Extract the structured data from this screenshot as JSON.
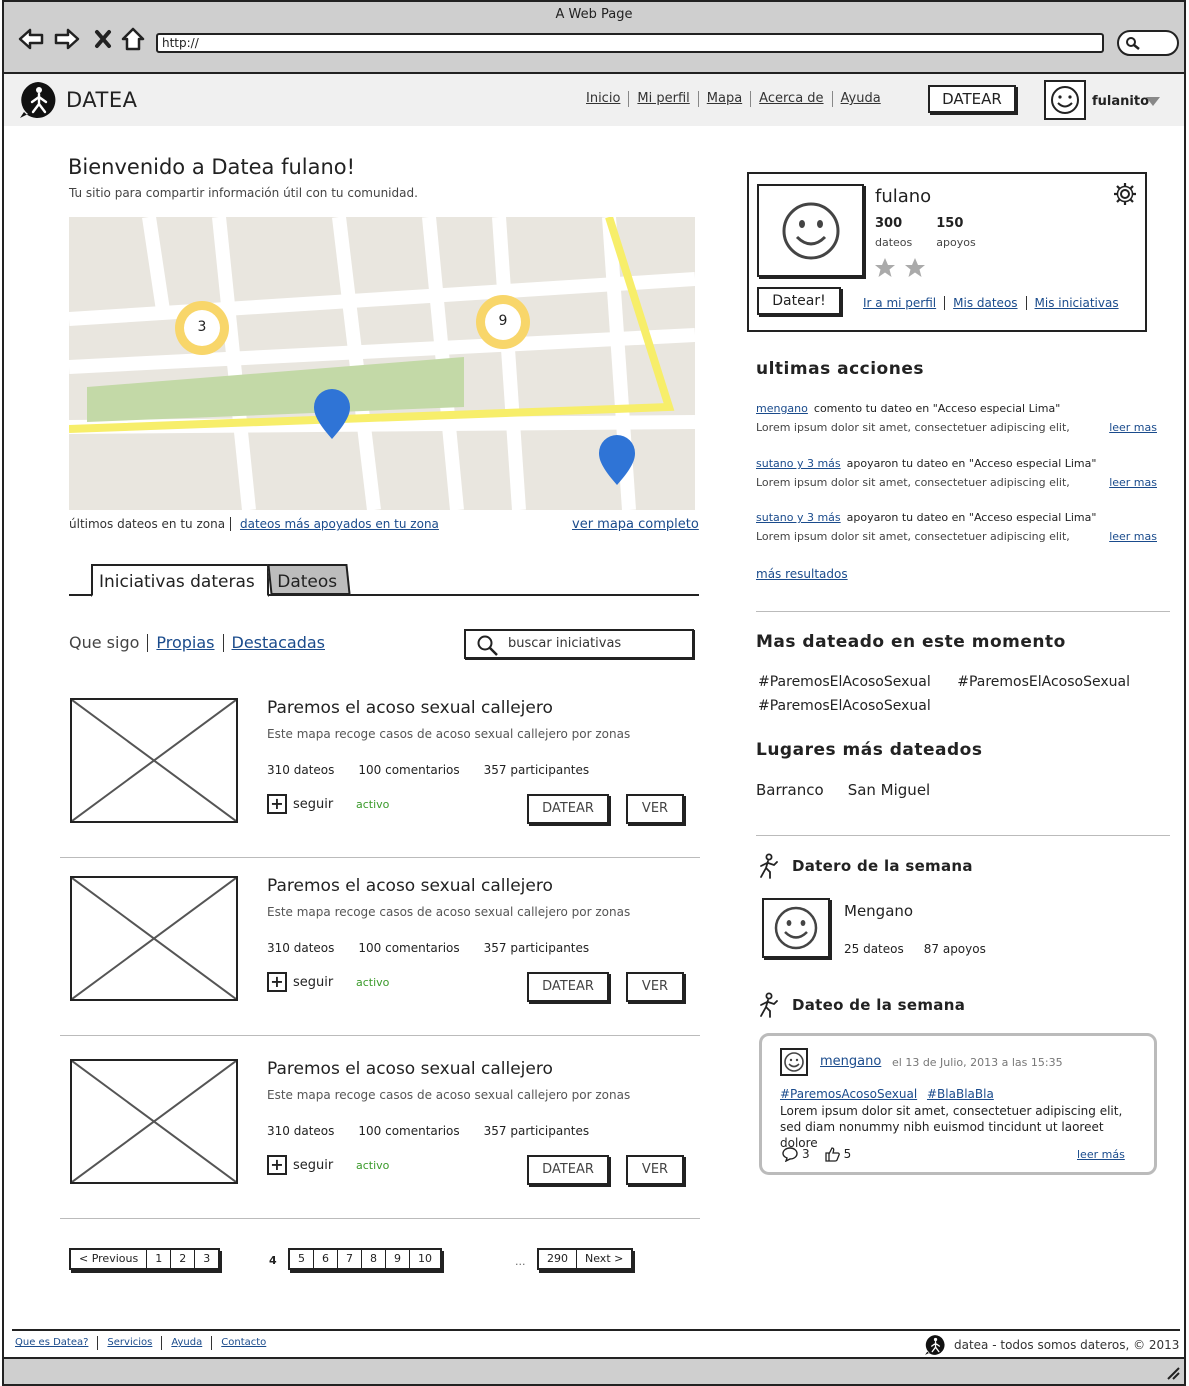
{
  "browser": {
    "title": "A Web Page",
    "url": "http://"
  },
  "header": {
    "logo_text": "DATEA",
    "nav": [
      "Inicio",
      "Mi perfil",
      "Mapa",
      "Acerca de",
      "Ayuda"
    ],
    "datear_button": "DATEAR",
    "username": "fulanito"
  },
  "welcome": {
    "title": "Bienvenido a Datea fulano!",
    "subtitle": "Tu sitio para compartir información útil con tu comunidad."
  },
  "map": {
    "clusters": [
      "3",
      "9"
    ],
    "caption_left": "últimos dateos en tu zona",
    "caption_mid": "dateos más apoyados en tu zona",
    "caption_right": "ver mapa completo"
  },
  "tabs": [
    "Iniciativas dateras",
    "Dateos"
  ],
  "filters": {
    "items": [
      "Que sigo",
      "Propias",
      "Destacadas"
    ],
    "search_placeholder": "buscar iniciativas"
  },
  "initiatives": [
    {
      "title": "Paremos el acoso sexual callejero",
      "desc": "Este mapa recoge casos de acoso sexual callejero por zonas",
      "dateos": "310 dateos",
      "comments": "100 comentarios",
      "participants": "357 participantes",
      "follow": "seguir",
      "state": "activo",
      "btn_datear": "DATEAR",
      "btn_ver": "VER"
    },
    {
      "title": "Paremos el acoso sexual callejero",
      "desc": "Este mapa recoge casos de acoso sexual callejero por zonas",
      "dateos": "310 dateos",
      "comments": "100 comentarios",
      "participants": "357 participantes",
      "follow": "seguir",
      "state": "activo",
      "btn_datear": "DATEAR",
      "btn_ver": "VER"
    },
    {
      "title": "Paremos el acoso sexual callejero",
      "desc": "Este mapa recoge casos de acoso sexual callejero por zonas",
      "dateos": "310 dateos",
      "comments": "100 comentarios",
      "participants": "357 participantes",
      "follow": "seguir",
      "state": "activo",
      "btn_datear": "DATEAR",
      "btn_ver": "VER"
    }
  ],
  "pagination": {
    "prev": "< Previous",
    "group1": [
      "1",
      "2",
      "3"
    ],
    "current": "4",
    "group2": [
      "5",
      "6",
      "7",
      "8",
      "9",
      "10"
    ],
    "dots": "...",
    "last": "290",
    "next": "Next >"
  },
  "profile": {
    "name": "fulano",
    "dateos_count": "300",
    "dateos_label": "dateos",
    "apoyos_count": "150",
    "apoyos_label": "apoyos",
    "datear_button": "Datear!",
    "links": [
      "Ir a mi perfil",
      "Mis dateos",
      "Mis iniciativas"
    ]
  },
  "recent": {
    "title": "ultimas acciones",
    "items": [
      {
        "who": "mengano",
        "text": "comento tu dateo en \"Acceso especial Lima\"",
        "body": "Lorem ipsum dolor sit amet, consectetuer adipiscing elit,",
        "more": "leer mas"
      },
      {
        "who": "sutano y 3 más",
        "text": "apoyaron tu dateo en \"Acceso especial Lima\"",
        "body": "Lorem ipsum dolor sit amet, consectetuer adipiscing elit,",
        "more": "leer mas"
      },
      {
        "who": "sutano y 3 más",
        "text": "apoyaron tu dateo en \"Acceso especial Lima\"",
        "body": "Lorem ipsum dolor sit amet, consectetuer adipiscing elit,",
        "more": "leer mas"
      }
    ],
    "more_results": "más resultados"
  },
  "trending": {
    "title": "Mas dateado en este momento",
    "tags": [
      "#ParemosElAcosoSexual",
      "#ParemosElAcosoSexual",
      "#ParemosElAcosoSexual"
    ]
  },
  "places": {
    "title": "Lugares más dateados",
    "items": [
      "Barranco",
      "San Miguel"
    ]
  },
  "datero_week": {
    "title": "Datero de la semana",
    "name": "Mengano",
    "dateos": "25 dateos",
    "apoyos": "87 apoyos"
  },
  "dateo_week": {
    "title": "Dateo de la semana",
    "user": "mengano",
    "date": "el 13 de Julio, 2013 a las 15:35",
    "tags": [
      "#ParemosAcosoSexual",
      "#BlaBlaBla"
    ],
    "text": "Lorem ipsum dolor sit amet, consectetuer adipiscing elit, sed diam nonummy nibh euismod tincidunt ut laoreet dolore",
    "comments": "3",
    "likes": "5",
    "more": "leer más"
  },
  "footer": {
    "links": [
      "Que es Datea?",
      "Servicios",
      "Ayuda",
      "Contacto"
    ],
    "copyright": "datea - todos somos dateros, © 2013"
  }
}
